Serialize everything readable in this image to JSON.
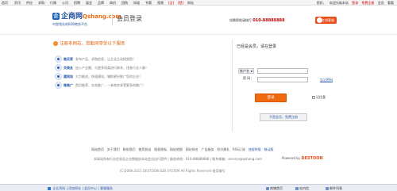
{
  "topnav": {
    "links": [
      "首页",
      "资讯",
      "供应",
      "求购",
      "行情",
      "公司",
      "招聘",
      "展会",
      "品牌",
      "商机",
      "团购",
      "知道",
      "专题",
      "视频",
      "[全]",
      "[登]",
      "网站"
    ],
    "right_greeting": "您好，",
    "right_name": "欢迎光临本站",
    "right_login": "登录",
    "right_register": "免费注册",
    "right_member": "会员",
    "right_more": "看看"
  },
  "header": {
    "logo_badge": "企",
    "logo_name": "企商网",
    "logo_domain": "Qshang.com",
    "logo_slogan": "中国领先的B2B商务平台",
    "page_title": "会员登录",
    "hotline_label": "如需帮助请拨打",
    "hotline_number": "010-88888888",
    "online_label": "在线客服"
  },
  "left": {
    "welcome": "注册本网站，您能同享受以下服务",
    "features": [
      {
        "name": "做买家",
        "desc": "发布产品、求购信息，让企业主动找到您！"
      },
      {
        "name": "交商友",
        "desc": "加入产业圈，与更多同类进行联系，找准行业人脉！"
      },
      {
        "name": "建网站",
        "desc": "大力推进，快速建站，辅助更好推广您的企业！"
      },
      {
        "name": "做推广",
        "desc": "首页推荐、业务推广，一来商务享受更多的推广！"
      }
    ]
  },
  "login": {
    "heading": "已经是会员，请在登录",
    "account_type": "帐户名",
    "username_value": "",
    "password_label": "密  码：",
    "password_value": "",
    "forgot": "忘记密码",
    "submit": "登录",
    "remember": "记住我",
    "register": "不是会员，免费注册"
  },
  "footer": {
    "links": [
      "网站首页",
      "关于我们",
      "联系我们",
      "使用协议",
      "版权隐私",
      "网站地图",
      "网站排名",
      "广告服务",
      "积分换礼",
      "RSS订阅"
    ],
    "links_alt": [
      "违规举报",
      "移动版"
    ],
    "contact": "本网站所有行业信息及企业数据由本站会员自行提供 | 服务热线：010-88888888 | 联系邮箱：service@qshang.com",
    "powered_prefix": "Powered by",
    "powered_brand": "DESTOON",
    "copyright": "(C)2008-2011 DESTOON B2B SYSTEM All Rights Reserved  备案编号"
  },
  "statusbar": {
    "left_items": [
      "企业资料",
      "添加网址",
      "会员中心",
      "客服服务"
    ],
    "right_items": [
      "商铺首页",
      "站内信",
      "邮件列表"
    ]
  }
}
